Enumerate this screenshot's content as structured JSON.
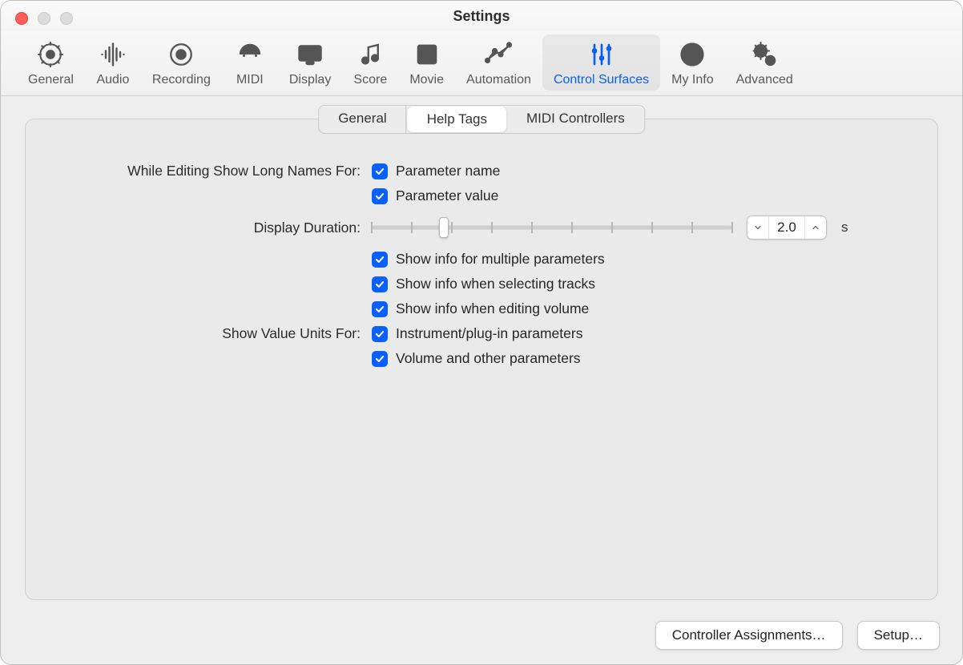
{
  "window": {
    "title": "Settings"
  },
  "toolbar": {
    "items": [
      {
        "label": "General"
      },
      {
        "label": "Audio"
      },
      {
        "label": "Recording"
      },
      {
        "label": "MIDI"
      },
      {
        "label": "Display"
      },
      {
        "label": "Score"
      },
      {
        "label": "Movie"
      },
      {
        "label": "Automation"
      },
      {
        "label": "Control Surfaces"
      },
      {
        "label": "My Info"
      },
      {
        "label": "Advanced"
      }
    ],
    "selected": "Control Surfaces"
  },
  "tabs": {
    "items": [
      {
        "label": "General"
      },
      {
        "label": "Help Tags"
      },
      {
        "label": "MIDI Controllers"
      }
    ],
    "selected": "Help Tags"
  },
  "form": {
    "editing_label": "While Editing Show Long Names For:",
    "param_name": "Parameter name",
    "param_value": "Parameter value",
    "display_duration_label": "Display Duration:",
    "duration_value": "2.0",
    "duration_unit": "s",
    "show_multiple": "Show info for multiple parameters",
    "show_tracks": "Show info when selecting tracks",
    "show_volume": "Show info when editing volume",
    "units_label": "Show Value Units For:",
    "units_instrument": "Instrument/plug-in parameters",
    "units_volume": "Volume and other parameters"
  },
  "footer": {
    "assignments": "Controller Assignments…",
    "setup": "Setup…"
  },
  "checkboxes": {
    "param_name": true,
    "param_value": true,
    "show_multiple": true,
    "show_tracks": true,
    "show_volume": true,
    "units_instrument": true,
    "units_volume": true
  },
  "slider": {
    "position_percent": 20,
    "ticks": 10
  }
}
